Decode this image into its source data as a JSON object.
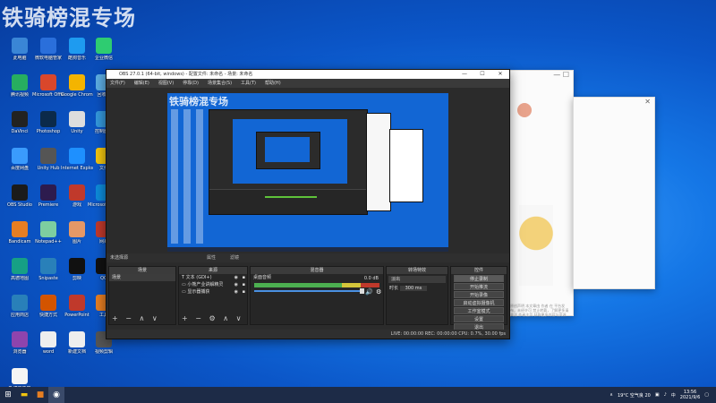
{
  "watermark": "铁骑榜混专场",
  "desktop_icons": [
    {
      "label": "此电脑",
      "icon": "pc-icon",
      "color": "#3a86d6"
    },
    {
      "label": "微软电脑管家",
      "icon": "shield-icon",
      "color": "#2a6fdb"
    },
    {
      "label": "酷狗音乐",
      "icon": "music-icon",
      "color": "#1e9bf0"
    },
    {
      "label": "企业微信",
      "icon": "wecom-icon",
      "color": "#2ecc71"
    },
    {
      "label": "腾讯视频",
      "icon": "video-icon",
      "color": "#27ae60"
    },
    {
      "label": "Microsoft Office",
      "icon": "office-icon",
      "color": "#d9472b"
    },
    {
      "label": "Google Chrome",
      "icon": "chrome-icon",
      "color": "#f4b400"
    },
    {
      "label": "回收站",
      "icon": "recycle-icon",
      "color": "#5dade2"
    },
    {
      "label": "DaVinci",
      "icon": "davinci-icon",
      "color": "#222"
    },
    {
      "label": "Photoshop",
      "icon": "ps-icon",
      "color": "#0b2a4a"
    },
    {
      "label": "Unity",
      "icon": "unity-icon",
      "color": "#ddd"
    },
    {
      "label": "控制面板",
      "icon": "panel-icon",
      "color": "#3498db"
    },
    {
      "label": "百度网盘",
      "icon": "cloud-icon",
      "color": "#3a9bfd"
    },
    {
      "label": "Unity Hub",
      "icon": "hub-icon",
      "color": "#555"
    },
    {
      "label": "Internet Explorer",
      "icon": "ie-icon",
      "color": "#1e90ff"
    },
    {
      "label": "文件",
      "icon": "folder-icon",
      "color": "#f1c40f"
    },
    {
      "label": "OBS Studio",
      "icon": "obs-icon",
      "color": "#1b1b1b"
    },
    {
      "label": "Premiere",
      "icon": "pr-icon",
      "color": "#2d1b4e"
    },
    {
      "label": "游戏",
      "icon": "game-icon",
      "color": "#c0392b"
    },
    {
      "label": "Microsoft Edge",
      "icon": "edge-icon",
      "color": "#0d8bd9"
    },
    {
      "label": "Bandicam",
      "icon": "bandicam-icon",
      "color": "#e67e22"
    },
    {
      "label": "Notepad++",
      "icon": "notepad-icon",
      "color": "#7dcea0"
    },
    {
      "label": "图片",
      "icon": "image-icon",
      "color": "#e59866"
    },
    {
      "label": "网易",
      "icon": "netease-icon",
      "color": "#c0392b"
    },
    {
      "label": "高德地图",
      "icon": "map-icon",
      "color": "#16a085"
    },
    {
      "label": "Snipaste",
      "icon": "snip-icon",
      "color": "#2980b9"
    },
    {
      "label": "剪映",
      "icon": "capcut-icon",
      "color": "#111"
    },
    {
      "label": "QQ",
      "icon": "qq-icon",
      "color": "#111"
    },
    {
      "label": "应用商店",
      "icon": "store-icon",
      "color": "#2980b9"
    },
    {
      "label": "快捷方式",
      "icon": "link-icon",
      "color": "#d35400"
    },
    {
      "label": "PowerPoint",
      "icon": "ppt-icon",
      "color": "#c0392b"
    },
    {
      "label": "工具",
      "icon": "tool-icon",
      "color": "#e67e22"
    },
    {
      "label": "浏览器",
      "icon": "browser-icon",
      "color": "#8e44ad"
    },
    {
      "label": "word",
      "icon": "word-icon",
      "color": "#eee"
    },
    {
      "label": "新建文档",
      "icon": "doc-icon",
      "color": "#eee"
    },
    {
      "label": "视频剪辑",
      "icon": "film-icon",
      "color": "#555"
    },
    {
      "label": "新建文件夹",
      "icon": "file-icon",
      "color": "#f5f5f5"
    }
  ],
  "obs": {
    "title": "OBS 27.0.1 (64-bit, windows) - 配置文件: 未命名 - 场景: 未命名",
    "menu": [
      "文件(F)",
      "编辑(E)",
      "视图(V)",
      "停靠(D)",
      "场景集合(S)",
      "工具(T)",
      "帮助(H)"
    ],
    "scene_bar": {
      "label": "未选择源",
      "properties": "属性",
      "filters": "滤镜"
    },
    "docks": {
      "scenes": {
        "header": "场景",
        "items": [
          "场景"
        ]
      },
      "sources": {
        "header": "来源",
        "items": [
          "文本 (GDI+)",
          "小熊产业讲解精灵",
          "显示器捕获"
        ]
      },
      "mixer": {
        "header": "混音器",
        "track": "桌面音频",
        "db": "0.0 dB"
      },
      "transitions": {
        "header": "转场特效",
        "type": "淡出",
        "duration_label": "时长",
        "duration": "300 ms"
      },
      "controls": {
        "header": "控件",
        "buttons": [
          "停止录制",
          "开始推流",
          "开始录像",
          "启动虚拟摄像机",
          "工作室模式",
          "设置",
          "退出"
        ]
      }
    },
    "status": "LIVE: 00:00:00   REC: 00:00:00   CPU: 0.7%, 30.00 fps"
  },
  "bg_window": {
    "close": "✕",
    "maximize": "☐",
    "minimize": "—"
  },
  "article_text": "原创声明 本文章由 作者 在 平台发布，未经许可 禁止转载，了解更多请关注 作者主页 获取更多内容与资源",
  "taskbar": {
    "weather": "19°C 空气良 20",
    "time": "13:56",
    "date": "2021/9/6"
  },
  "colors": {
    "desktop": "#1577e6",
    "obs_bg": "#2b2b2b",
    "taskbar": "#1d2b47"
  }
}
